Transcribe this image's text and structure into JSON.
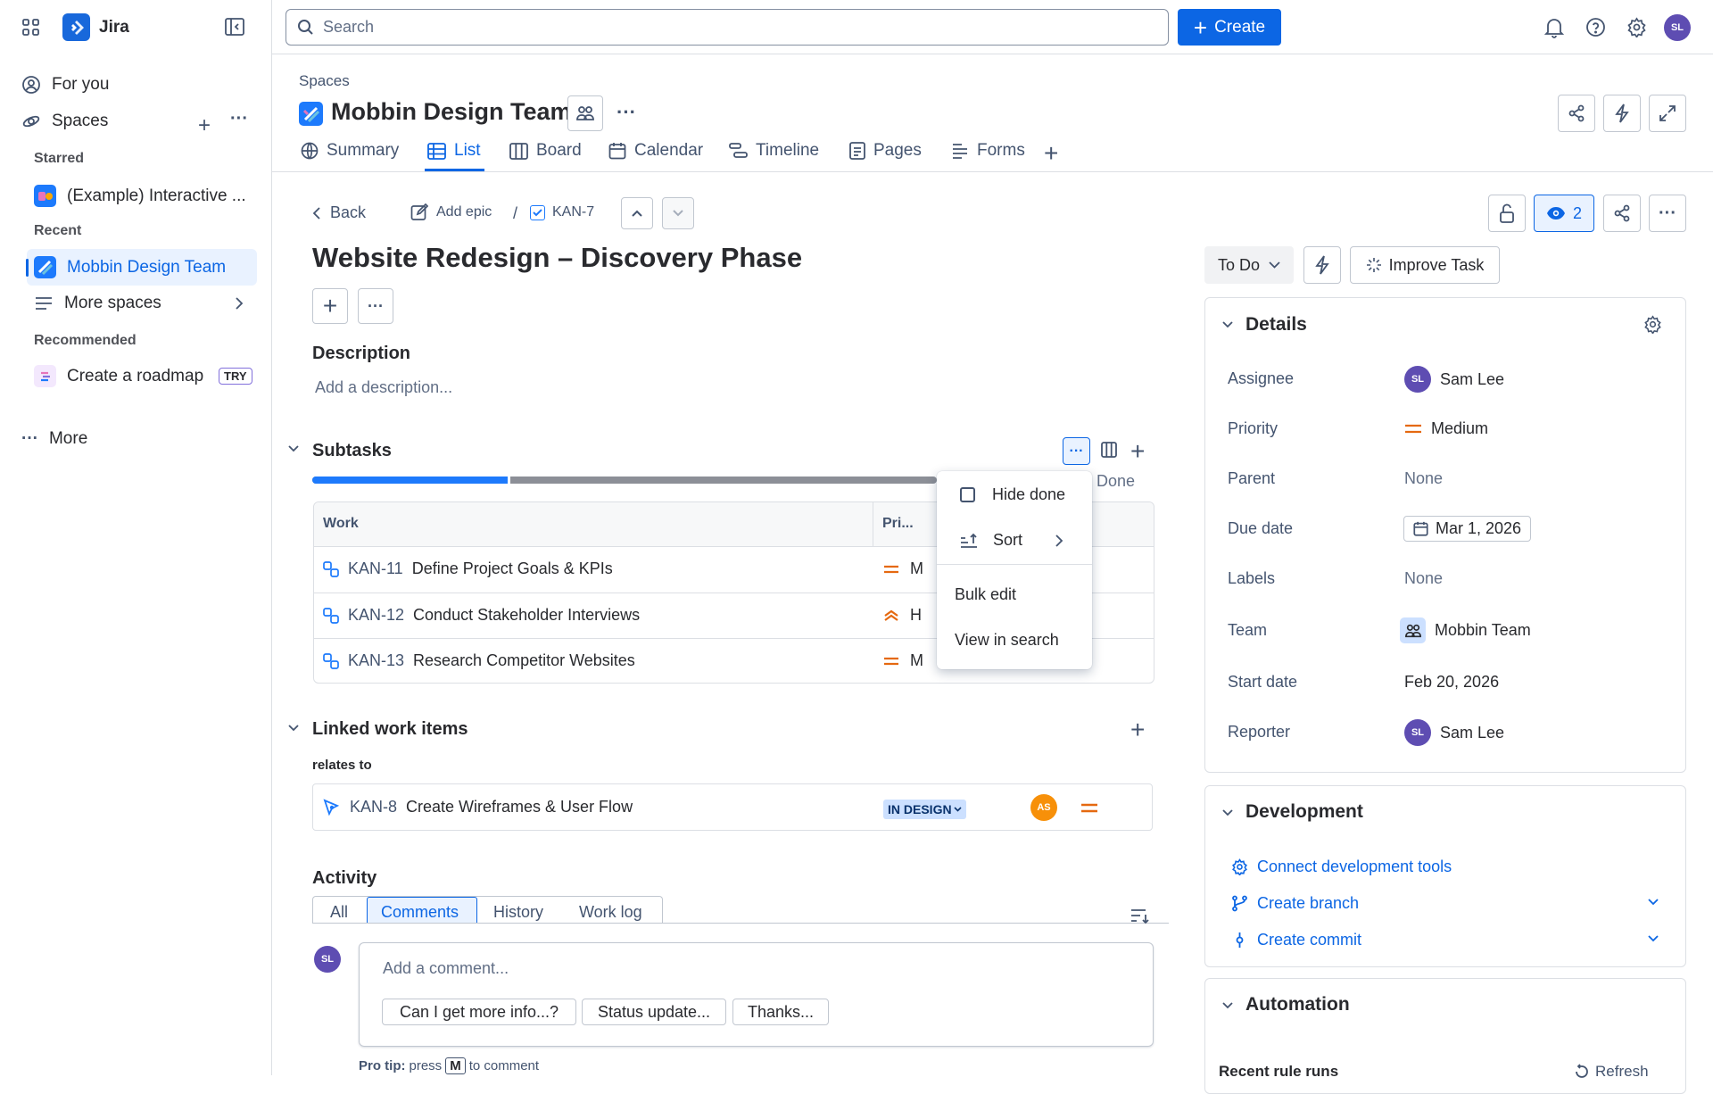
{
  "app": {
    "name": "Jira"
  },
  "search": {
    "placeholder": "Search"
  },
  "topbar": {
    "create_label": "Create",
    "avatar_initials": "SL"
  },
  "sidebar": {
    "for_you": "For you",
    "spaces": "Spaces",
    "starred_heading": "Starred",
    "starred_item": "(Example) Interactive ...",
    "recent_heading": "Recent",
    "recent_item": "Mobbin Design Team",
    "more_spaces": "More spaces",
    "recommended_heading": "Recommended",
    "roadmap": "Create a roadmap",
    "try_badge": "TRY",
    "more": "More"
  },
  "header": {
    "breadcrumb": "Spaces",
    "space_title": "Mobbin Design Team",
    "tabs": [
      "Summary",
      "List",
      "Board",
      "Calendar",
      "Timeline",
      "Pages",
      "Forms"
    ]
  },
  "issue": {
    "back": "Back",
    "add_epic": "Add epic",
    "separator": "/",
    "key": "KAN-7",
    "title": "Website Redesign – Discovery Phase",
    "description_heading": "Description",
    "description_placeholder": "Add a description...",
    "watch_count": "2"
  },
  "subtasks": {
    "heading": "Subtasks",
    "done_label": "Done",
    "progress_done_fraction": 0.32,
    "col_work": "Work",
    "col_priority": "Pri...",
    "rows": [
      {
        "key": "KAN-11",
        "summary": "Define Project Goals & KPIs",
        "priority": "M"
      },
      {
        "key": "KAN-12",
        "summary": "Conduct Stakeholder Interviews",
        "priority": "H"
      },
      {
        "key": "KAN-13",
        "summary": "Research Competitor Websites",
        "priority": "M"
      }
    ]
  },
  "menu": {
    "hide_done": "Hide done",
    "sort": "Sort",
    "bulk_edit": "Bulk edit",
    "view_in_search": "View in search"
  },
  "linked": {
    "heading": "Linked work items",
    "relation": "relates to",
    "key": "KAN-8",
    "summary": "Create Wireframes & User Flow",
    "status": "IN DESIGN",
    "assignee_initials": "AS"
  },
  "activity": {
    "heading": "Activity",
    "tabs": [
      "All",
      "Comments",
      "History",
      "Work log"
    ],
    "comment_placeholder": "Add a comment...",
    "quick_replies": [
      "Can I get more info...?",
      "Status update...",
      "Thanks..."
    ],
    "pro_tip_prefix": "Pro tip:",
    "pro_tip_press": "press",
    "pro_tip_key": "M",
    "pro_tip_suffix": "to comment",
    "avatar_initials": "SL"
  },
  "status_bar": {
    "status": "To Do",
    "improve": "Improve Task"
  },
  "details": {
    "heading": "Details",
    "assignee_label": "Assignee",
    "assignee": "Sam Lee",
    "assignee_initials": "SL",
    "priority_label": "Priority",
    "priority": "Medium",
    "parent_label": "Parent",
    "parent": "None",
    "due_label": "Due date",
    "due": "Mar 1, 2026",
    "labels_label": "Labels",
    "labels": "None",
    "team_label": "Team",
    "team": "Mobbin Team",
    "start_label": "Start date",
    "start": "Feb 20, 2026",
    "reporter_label": "Reporter",
    "reporter": "Sam Lee",
    "reporter_initials": "SL"
  },
  "development": {
    "heading": "Development",
    "connect": "Connect development tools",
    "branch": "Create branch",
    "commit": "Create commit"
  },
  "automation": {
    "heading": "Automation",
    "recent_runs": "Recent rule runs",
    "refresh": "Refresh"
  },
  "colors": {
    "accent": "#0c66e4",
    "priority_orange": "#e56910",
    "status_blue": "#cce0ff"
  }
}
